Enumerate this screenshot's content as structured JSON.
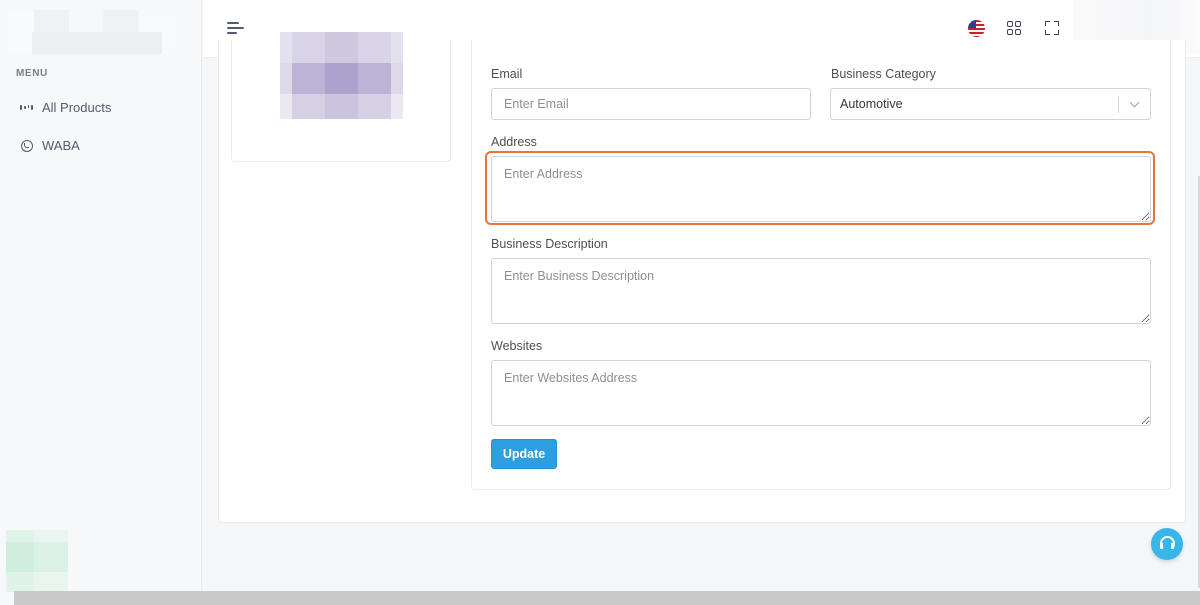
{
  "sidebar": {
    "menu_title": "MENU",
    "items": [
      {
        "label": "All Products",
        "icon": "grid-icon"
      },
      {
        "label": "WABA",
        "icon": "whatsapp-icon"
      }
    ]
  },
  "topbar": {
    "language_icon": "us-flag-icon",
    "apps_icon": "apps-grid-icon",
    "fullscreen_icon": "fullscreen-icon"
  },
  "form": {
    "email": {
      "label": "Email",
      "placeholder": "Enter Email",
      "value": ""
    },
    "business_category": {
      "label": "Business Category",
      "value": "Automotive"
    },
    "address": {
      "label": "Address",
      "placeholder": "Enter Address",
      "value": ""
    },
    "business_description": {
      "label": "Business Description",
      "placeholder": "Enter Business Description",
      "value": ""
    },
    "websites": {
      "label": "Websites",
      "placeholder": "Enter Websites Address",
      "value": ""
    },
    "update_label": "Update"
  },
  "colors": {
    "accent": "#2d9fe0",
    "focus_ring": "#e8743b",
    "support_button": "#38b6ea"
  }
}
